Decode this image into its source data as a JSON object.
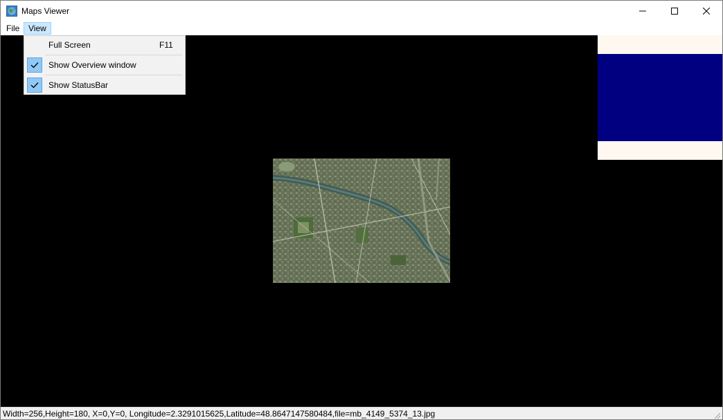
{
  "window": {
    "title": "Maps Viewer",
    "app_icon": "globe-map-icon",
    "controls": [
      "minimize-icon",
      "maximize-icon",
      "close-icon"
    ]
  },
  "menubar": {
    "items": [
      {
        "label": "File"
      },
      {
        "label": "View",
        "active": true
      }
    ]
  },
  "view_menu": {
    "items": [
      {
        "label": "Full Screen",
        "shortcut": "F11",
        "checked": false
      },
      {
        "label": "Show Overview window",
        "checked": true
      },
      {
        "label": "Show StatusBar",
        "checked": true
      }
    ]
  },
  "overview": {
    "background_color": "#fff8f0",
    "viewport_color": "#000080"
  },
  "statusbar": {
    "text": "Width=256,Height=180, X=0,Y=0, Longitude=2.3291015625,Latitude=48.8647147580484,file=mb_4149_5374_13.jpg"
  },
  "colors": {
    "menu_highlight": "#cce8ff",
    "check_background": "#90c8f6"
  }
}
